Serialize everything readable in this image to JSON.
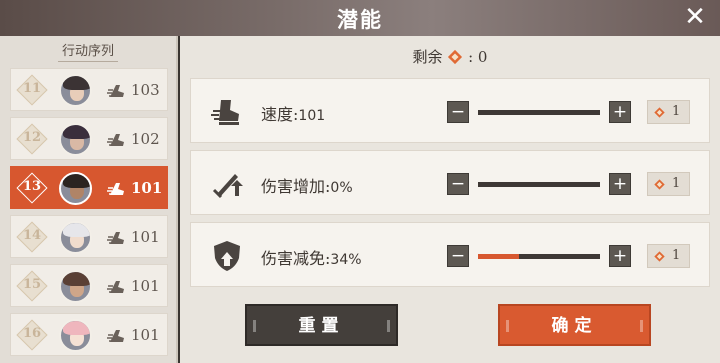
{
  "header": {
    "title": "潜能",
    "close_label": "✕"
  },
  "sidebar": {
    "title": "行动序列",
    "items": [
      {
        "num": "11",
        "speed": "103",
        "active": false,
        "hair": "#3b3334",
        "skin": "#e8cdb9"
      },
      {
        "num": "12",
        "speed": "102",
        "active": false,
        "hair": "#3a2e3c",
        "skin": "#d9b9a5"
      },
      {
        "num": "13",
        "speed": "101",
        "active": true,
        "hair": "#2b2420",
        "skin": "#b08467"
      },
      {
        "num": "14",
        "speed": "101",
        "active": false,
        "hair": "#e6e6ea",
        "skin": "#f0dccd"
      },
      {
        "num": "15",
        "speed": "101",
        "active": false,
        "hair": "#5a4035",
        "skin": "#cfa689"
      },
      {
        "num": "16",
        "speed": "101",
        "active": false,
        "hair": "#efb6bd",
        "skin": "#f5e1d4"
      }
    ]
  },
  "remain": {
    "label": "剩余",
    "value": ": 0"
  },
  "stats": [
    {
      "label": "速度:",
      "value": "101",
      "cost": "1",
      "fill": 0,
      "icon": "boot-speed-icon"
    },
    {
      "label": "伤害增加:",
      "value": "0%",
      "cost": "1",
      "fill": 0,
      "icon": "sword-up-icon"
    },
    {
      "label": "伤害减免:",
      "value": "34%",
      "cost": "1",
      "fill": 0.34,
      "icon": "shield-up-icon"
    }
  ],
  "buttons": {
    "reset": "重置",
    "confirm": "确定"
  },
  "colors": {
    "accent": "#d7572f",
    "dark": "#443f3b"
  }
}
